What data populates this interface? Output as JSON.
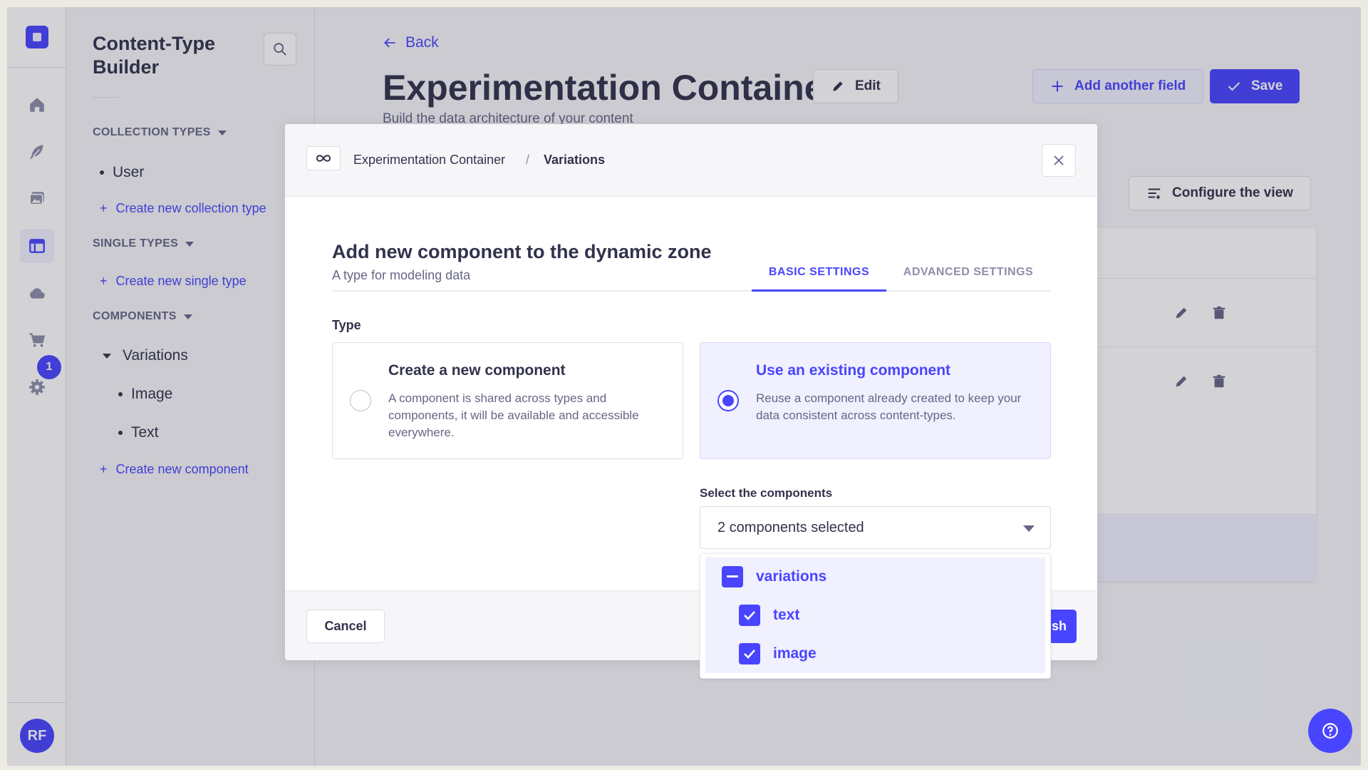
{
  "nav": {
    "badge_count": "1",
    "avatar_initials": "RF",
    "items": [
      {
        "icon": "home-icon"
      },
      {
        "icon": "feather-icon"
      },
      {
        "icon": "media-library-icon"
      },
      {
        "icon": "content-type-builder-icon",
        "active": true
      },
      {
        "icon": "cloud-icon"
      },
      {
        "icon": "cart-icon"
      },
      {
        "icon": "gear-icon"
      }
    ]
  },
  "subnav": {
    "title": "Content-Type Builder",
    "collection_types": {
      "heading": "COLLECTION TYPES",
      "items": [
        "User"
      ],
      "create_label": "Create new collection type"
    },
    "single_types": {
      "heading": "SINGLE TYPES",
      "create_label": "Create new single type"
    },
    "components": {
      "heading": "COMPONENTS",
      "category": "Variations",
      "items": [
        "Image",
        "Text"
      ],
      "create_label": "Create new component"
    }
  },
  "main": {
    "back_label": "Back",
    "title": "Experimentation Container",
    "subtitle": "Build the data architecture of your content",
    "edit_label": "Edit",
    "add_field_label": "Add another field",
    "save_label": "Save",
    "configure_label": "Configure the view"
  },
  "modal": {
    "breadcrumb_parent": "Experimentation Container",
    "breadcrumb_separator": "/",
    "breadcrumb_current": "Variations",
    "title": "Add new component to the dynamic zone",
    "subtitle": "A type for modeling data",
    "tabs": {
      "basic": "BASIC SETTINGS",
      "advanced": "ADVANCED SETTINGS"
    },
    "type_label": "Type",
    "options": {
      "create": {
        "title": "Create a new component",
        "description": "A component is shared across types and components, it will be available and accessible everywhere."
      },
      "existing": {
        "title": "Use an existing component",
        "description": "Reuse a component already created to keep your data consistent across content-types."
      }
    },
    "select_label": "Select the components",
    "select_value": "2 components selected",
    "dropdown": {
      "group": "variations",
      "children": [
        "text",
        "image"
      ]
    },
    "cancel_label": "Cancel",
    "finish_label": "Finish"
  },
  "colors": {
    "primary": "#4945ff",
    "primary_light": "#f0f0ff",
    "text": "#32324d",
    "muted": "#666687"
  }
}
